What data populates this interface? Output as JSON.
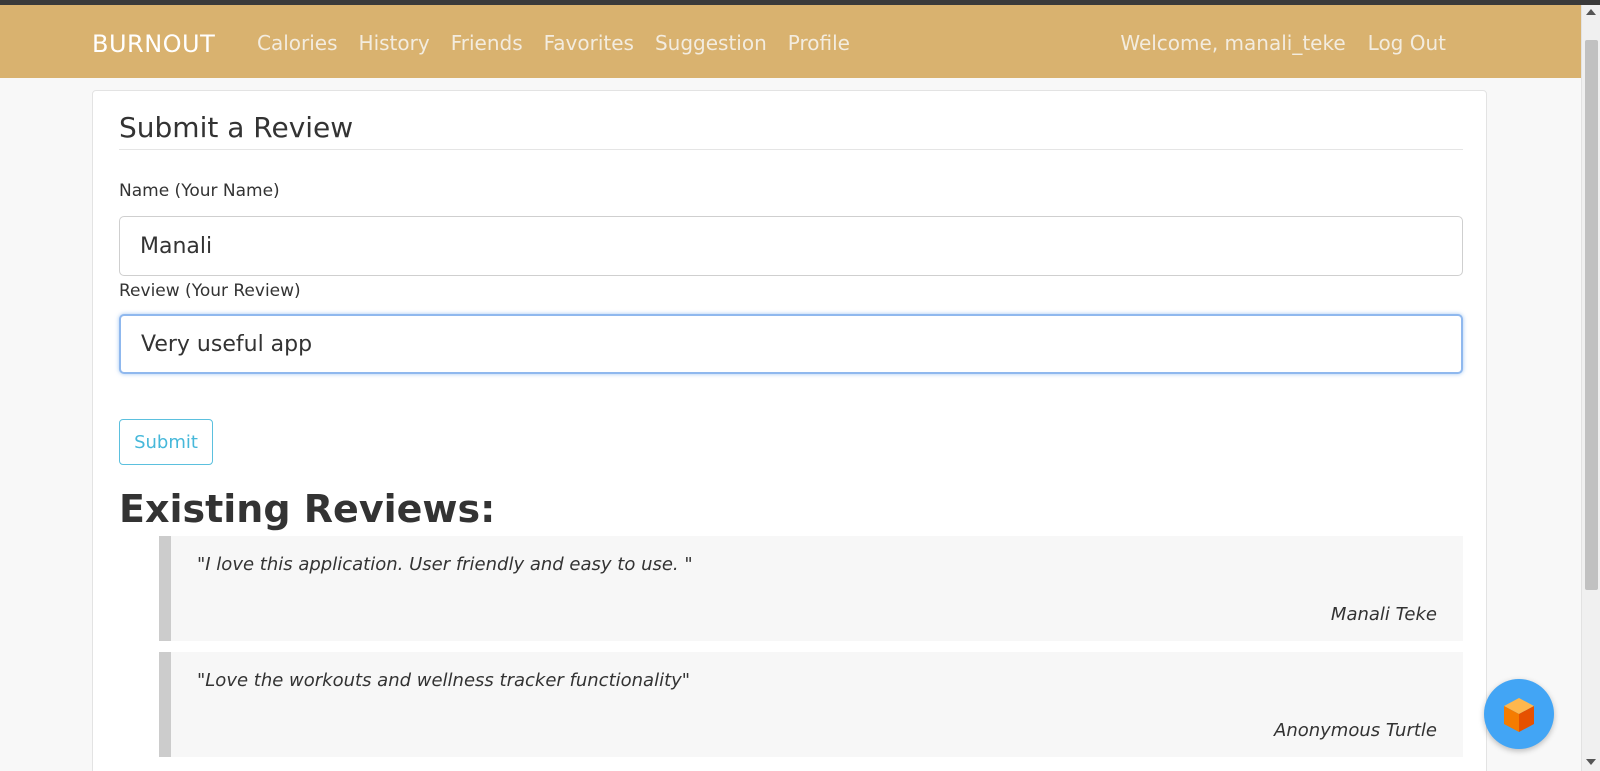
{
  "navbar": {
    "brand": "BURNOUT",
    "links": [
      "Calories",
      "History",
      "Friends",
      "Favorites",
      "Suggestion",
      "Profile"
    ],
    "welcome": "Welcome, manali_teke",
    "logout": "Log Out",
    "color": "#d9b26f"
  },
  "form": {
    "title": "Submit a Review",
    "name_label": "Name (Your Name)",
    "name_value": "Manali",
    "review_label": "Review (Your Review)",
    "review_value": "Very useful app",
    "submit_label": "Submit"
  },
  "reviews": {
    "heading": "Existing Reviews:",
    "items": [
      {
        "quote": "\"I love this application. User friendly and easy to use. \"",
        "author": "Manali Teke"
      },
      {
        "quote": "\"Love the workouts and wellness tracker functionality\"",
        "author": "Anonymous Turtle"
      }
    ]
  },
  "fab": {
    "icon": "cube-icon",
    "color": "#42a5f5"
  }
}
